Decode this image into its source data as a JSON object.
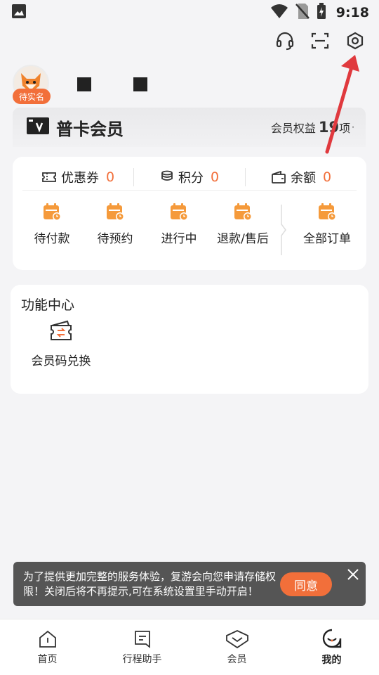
{
  "status_bar": {
    "time": "9:18"
  },
  "profile": {
    "verify_badge": "待实名"
  },
  "member": {
    "title": "普卡会员",
    "benefits_label": "会员权益",
    "benefits_count": "19",
    "benefits_unit": "项"
  },
  "assets": [
    {
      "label": "优惠券",
      "value": "0",
      "icon": "ticket-icon"
    },
    {
      "label": "积分",
      "value": "0",
      "icon": "coins-icon"
    },
    {
      "label": "余额",
      "value": "0",
      "icon": "wallet-icon"
    }
  ],
  "orders": [
    {
      "label": "待付款",
      "icon": "calendar-clock-icon"
    },
    {
      "label": "待预约",
      "icon": "calendar-clock-icon"
    },
    {
      "label": "进行中",
      "icon": "calendar-clock-icon"
    },
    {
      "label": "退款/售后",
      "icon": "calendar-clock-icon"
    },
    {
      "label": "全部订单",
      "icon": "calendar-clock-icon"
    }
  ],
  "functions": {
    "title": "功能中心",
    "items": [
      {
        "label": "会员码兑换",
        "icon": "exchange-ticket-icon"
      }
    ]
  },
  "toast": {
    "text": "为了提供更加完整的服务体验，复游会向您申请存储权限！关闭后将不再提示,可在系统设置里手动开启！",
    "agree_label": "同意"
  },
  "nav": [
    {
      "label": "首页",
      "icon": "home-icon"
    },
    {
      "label": "行程助手",
      "icon": "itinerary-icon"
    },
    {
      "label": "会员",
      "icon": "member-icon"
    },
    {
      "label": "我的",
      "icon": "me-icon"
    }
  ],
  "colors": {
    "accent": "#f26f3a",
    "annotation_arrow": "#e0393e"
  }
}
